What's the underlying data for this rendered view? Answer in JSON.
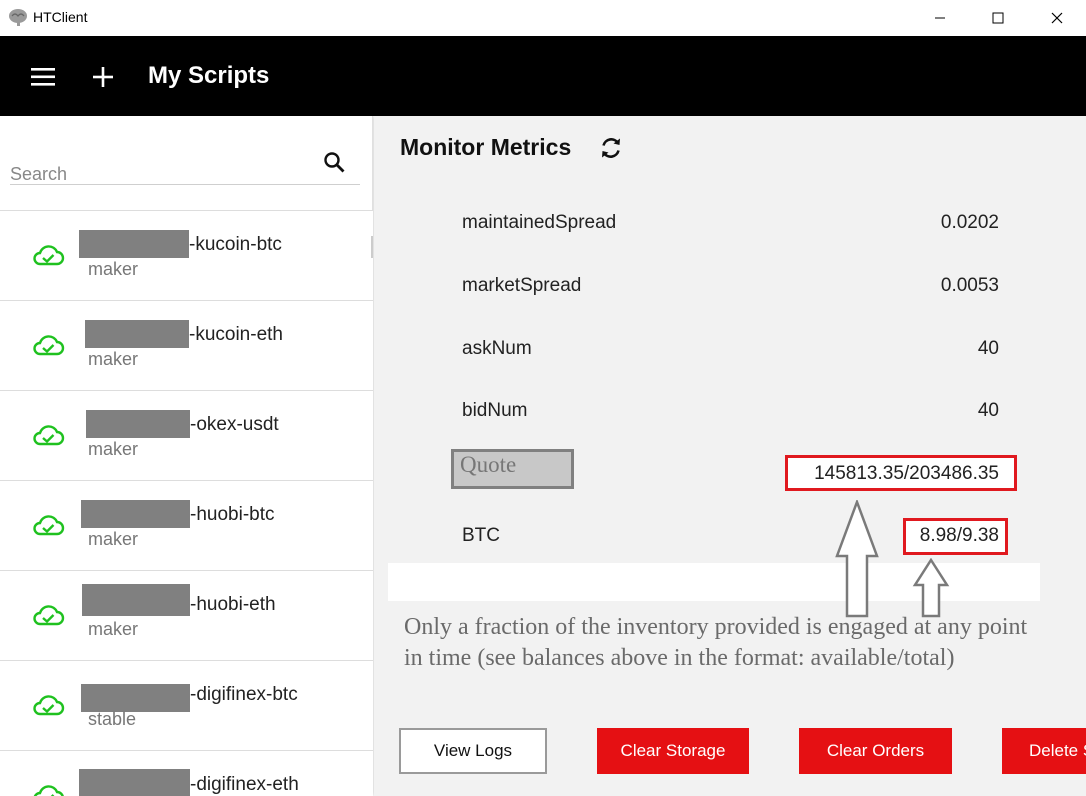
{
  "window": {
    "title": "HTClient"
  },
  "appbar": {
    "title": "My Scripts"
  },
  "search": {
    "placeholder": "Search"
  },
  "scripts": [
    {
      "name": "-kucoin-btc",
      "type": "maker"
    },
    {
      "name": "-kucoin-eth",
      "type": "maker"
    },
    {
      "name": "-okex-usdt",
      "type": "maker"
    },
    {
      "name": "-huobi-btc",
      "type": "maker"
    },
    {
      "name": "-huobi-eth",
      "type": "maker"
    },
    {
      "name": "-digifinex-btc",
      "type": "stable"
    },
    {
      "name": "-digifinex-eth",
      "type": ""
    }
  ],
  "main": {
    "title": "Monitor Metrics",
    "metrics": [
      {
        "label": "maintainedSpread",
        "value": "0.0202"
      },
      {
        "label": "marketSpread",
        "value": "0.0053"
      },
      {
        "label": "askNum",
        "value": "40"
      },
      {
        "label": "bidNum",
        "value": "40"
      },
      {
        "label": "Quote",
        "value": "145813.35/203486.35"
      },
      {
        "label": "BTC",
        "value": "8.98/9.38"
      }
    ],
    "note": "Only a fraction of the inventory provided is engaged at any point in time (see balances above in the format: available/total)"
  },
  "buttons": {
    "view_logs": "View Logs",
    "clear_storage": "Clear Storage",
    "clear_orders": "Clear Orders",
    "delete": "Delete S"
  },
  "colors": {
    "status_green": "#1fc11f",
    "accent_red": "#e51013",
    "highlight_red": "#e0191f"
  }
}
